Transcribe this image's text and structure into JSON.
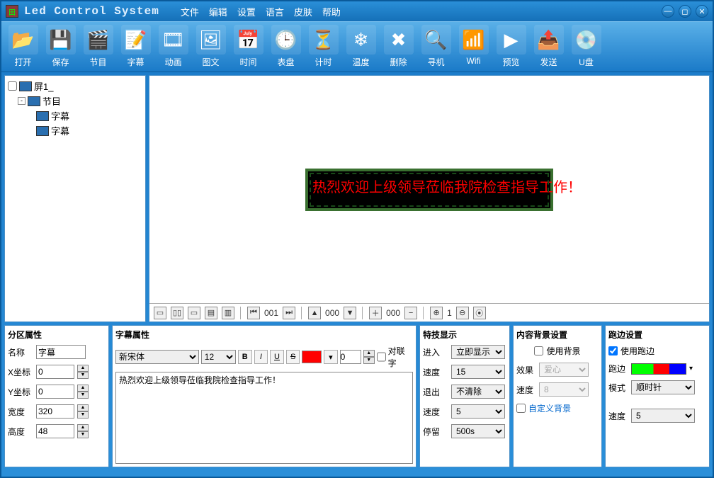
{
  "app": {
    "title": "Led Control System"
  },
  "menus": [
    "文件",
    "编辑",
    "设置",
    "语言",
    "皮肤",
    "帮助"
  ],
  "toolbar": [
    {
      "label": "打开",
      "icon": "📂"
    },
    {
      "label": "保存",
      "icon": "💾"
    },
    {
      "label": "节目",
      "icon": "🎬"
    },
    {
      "label": "字幕",
      "icon": "📝"
    },
    {
      "label": "动画",
      "icon": "🎞"
    },
    {
      "label": "图文",
      "icon": "🖼"
    },
    {
      "label": "时间",
      "icon": "📅"
    },
    {
      "label": "表盘",
      "icon": "🕒"
    },
    {
      "label": "计时",
      "icon": "⏳"
    },
    {
      "label": "温度",
      "icon": "❄"
    },
    {
      "label": "删除",
      "icon": "✖"
    },
    {
      "label": "寻机",
      "icon": "🔍"
    },
    {
      "label": "Wifi",
      "icon": "📶"
    },
    {
      "label": "预览",
      "icon": "▶"
    },
    {
      "label": "发送",
      "icon": "📤"
    },
    {
      "label": "U盘",
      "icon": "💿"
    }
  ],
  "tree": {
    "root": "屏1_",
    "program": "节目",
    "subs": [
      "字幕",
      "字幕"
    ]
  },
  "led_text": "热烈欢迎上级领导莅临我院检查指导工作！",
  "preview_bar": {
    "num1": "001",
    "num2": "000",
    "num3": "000"
  },
  "zone": {
    "title": "分区属性",
    "name_l": "名称",
    "name_v": "字幕",
    "x_l": "X坐标",
    "x_v": "0",
    "y_l": "Y坐标",
    "y_v": "0",
    "w_l": "宽度",
    "w_v": "320",
    "h_l": "高度",
    "h_v": "48"
  },
  "subtitle": {
    "title": "字幕属性",
    "font": "新宋体",
    "size": "12",
    "kern_l": "对联字",
    "text": "热烈欢迎上级领导莅临我院检查指导工作！"
  },
  "fx": {
    "title": "特技显示",
    "in_l": "进入",
    "in_v": "立即显示",
    "sp1_l": "速度",
    "sp1_v": "15",
    "out_l": "退出",
    "out_v": "不清除",
    "sp2_l": "速度",
    "sp2_v": "5",
    "stay_l": "停留",
    "stay_v": "500s"
  },
  "bg": {
    "title": "内容背景设置",
    "use_l": "使用背景",
    "fx_l": "效果",
    "fx_v": "爱心",
    "sp_l": "速度",
    "sp_v": "8",
    "custom": "自定义背景"
  },
  "edge": {
    "title": "跑边设置",
    "use_l": "使用跑边",
    "edge_l": "跑边",
    "mode_l": "模式",
    "mode_v": "顺时针",
    "sp_l": "速度",
    "sp_v": "5"
  }
}
